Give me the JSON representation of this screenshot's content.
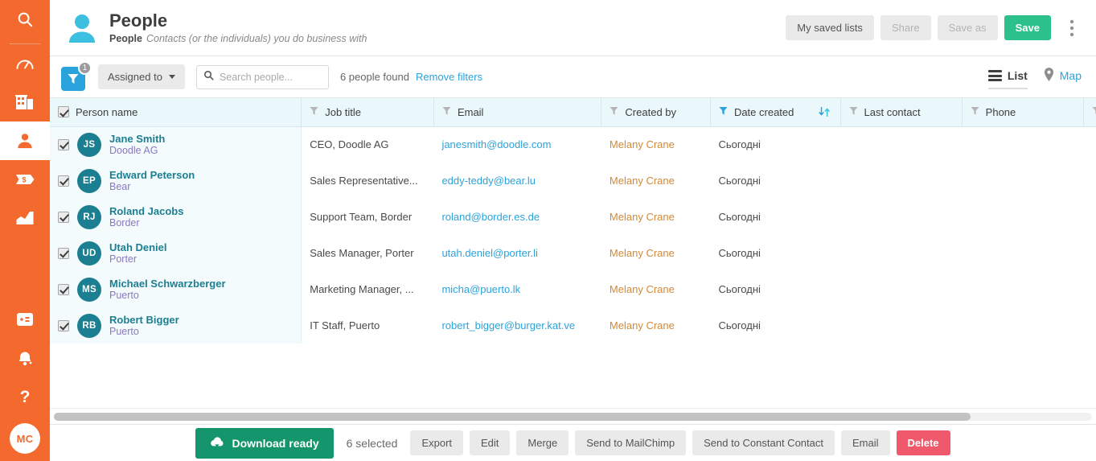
{
  "sidebar": {
    "items": [
      {
        "name": "search",
        "icon": "search-icon"
      },
      {
        "name": "dashboard",
        "icon": "gauge-icon"
      },
      {
        "name": "companies",
        "icon": "building-icon"
      },
      {
        "name": "people",
        "icon": "person-icon",
        "active": true
      },
      {
        "name": "deals",
        "icon": "price-tag-dollar-icon"
      },
      {
        "name": "reports",
        "icon": "chart-area-icon"
      },
      {
        "name": "apps",
        "icon": "apps-window-icon"
      },
      {
        "name": "notifications",
        "icon": "bell-icon"
      },
      {
        "name": "help",
        "icon": "question-mark-icon"
      }
    ],
    "user_initials": "MC"
  },
  "header": {
    "title": "People",
    "subtitle_strong": "People",
    "subtitle_desc": "Contacts (or the individuals) you do business with",
    "buttons": {
      "saved_lists": "My saved lists",
      "share": "Share",
      "save_as": "Save as",
      "save": "Save"
    }
  },
  "toolbar": {
    "filter_badge": "1",
    "assigned_to": "Assigned to",
    "search_placeholder": "Search people...",
    "search_value": "",
    "found_text": "6 people found",
    "remove_filters": "Remove filters",
    "view_list": "List",
    "view_map": "Map"
  },
  "table": {
    "columns": [
      {
        "label": "Person name",
        "filter": false,
        "sort": false
      },
      {
        "label": "Job title",
        "filter": true,
        "sort": false
      },
      {
        "label": "Email",
        "filter": true,
        "sort": false
      },
      {
        "label": "Created by",
        "filter": true,
        "sort": false
      },
      {
        "label": "Date created",
        "filter": true,
        "filter_active": true,
        "sort": true
      },
      {
        "label": "Last contact",
        "filter": true,
        "sort": false
      },
      {
        "label": "Phone",
        "filter": true,
        "sort": false
      }
    ],
    "rows": [
      {
        "checked": true,
        "initials": "JS",
        "name": "Jane Smith",
        "company": "Doodle AG",
        "job_title": "CEO, Doodle AG",
        "email": "janesmith@doodle.com",
        "created_by": "Melany Crane",
        "date_created": "Сьогодні",
        "last_contact": "",
        "phone": ""
      },
      {
        "checked": true,
        "initials": "EP",
        "name": "Edward Peterson",
        "company": "Bear",
        "job_title": "Sales Representative...",
        "email": "eddy-teddy@bear.lu",
        "created_by": "Melany Crane",
        "date_created": "Сьогодні",
        "last_contact": "",
        "phone": ""
      },
      {
        "checked": true,
        "initials": "RJ",
        "name": "Roland Jacobs",
        "company": "Border",
        "job_title": "Support Team, Border",
        "email": "roland@border.es.de",
        "created_by": "Melany Crane",
        "date_created": "Сьогодні",
        "last_contact": "",
        "phone": ""
      },
      {
        "checked": true,
        "initials": "UD",
        "name": "Utah Deniel",
        "company": "Porter",
        "job_title": "Sales Manager, Porter",
        "email": "utah.deniel@porter.li",
        "created_by": "Melany Crane",
        "date_created": "Сьогодні",
        "last_contact": "",
        "phone": ""
      },
      {
        "checked": true,
        "initials": "MS",
        "name": "Michael Schwarzberger",
        "company": "Puerto",
        "job_title": "Marketing Manager, ...",
        "email": "micha@puerto.lk",
        "created_by": "Melany Crane",
        "date_created": "Сьогодні",
        "last_contact": "",
        "phone": ""
      },
      {
        "checked": true,
        "initials": "RB",
        "name": "Robert Bigger",
        "company": "Puerto",
        "job_title": "IT Staff, Puerto",
        "email": "robert_bigger@burger.kat.ve",
        "created_by": "Melany Crane",
        "date_created": "Сьогодні",
        "last_contact": "",
        "phone": ""
      }
    ]
  },
  "actionbar": {
    "download": "Download ready",
    "selected": "6 selected",
    "export": "Export",
    "edit": "Edit",
    "merge": "Merge",
    "mailchimp": "Send to MailChimp",
    "constant_contact": "Send to Constant Contact",
    "email": "Email",
    "delete": "Delete"
  },
  "colors": {
    "brand_orange": "#f4692e",
    "accent_blue": "#2aa3dd",
    "teal": "#1b7f91",
    "green_save": "#2cc08a",
    "green_download": "#15956b",
    "red_delete": "#f0596b",
    "purple_company": "#8a78c2",
    "orange_creator": "#d08a3a"
  }
}
